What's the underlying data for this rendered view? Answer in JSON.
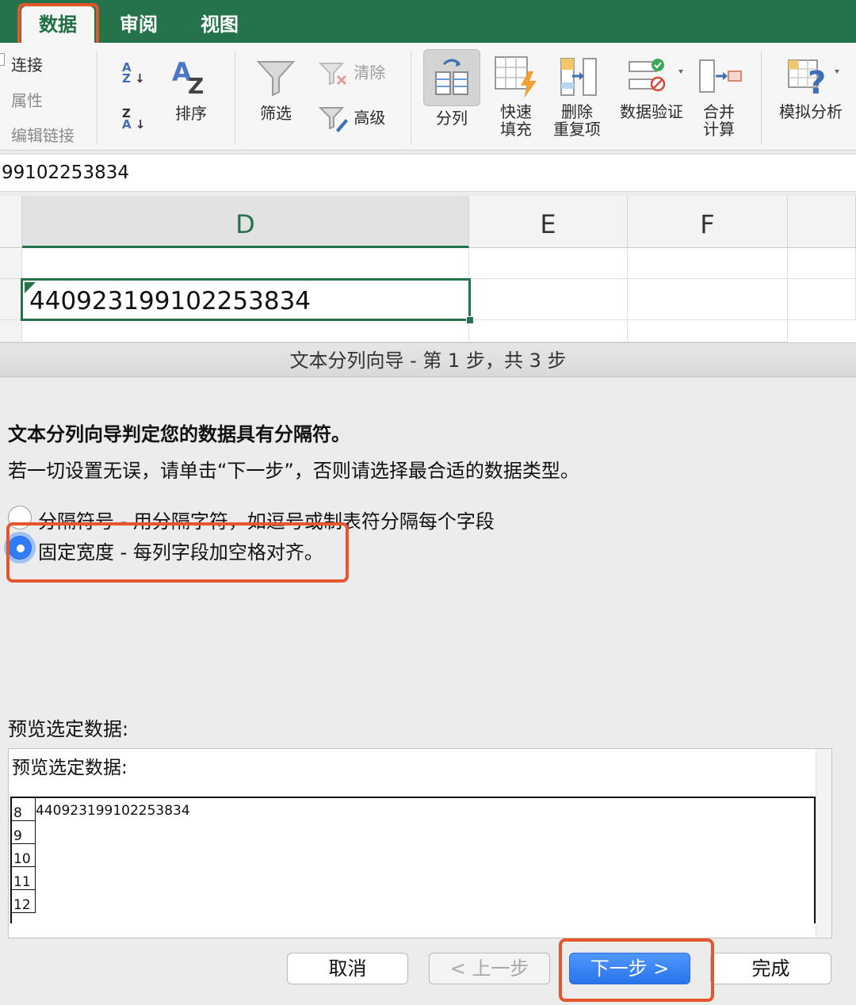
{
  "ribbon_tabs": {
    "data": "数据",
    "review": "审阅",
    "view": "视图"
  },
  "colors": {
    "excel_green": "#25734a",
    "highlight": "#e4572e",
    "primary_button": "#2a73ea"
  },
  "ribbon": {
    "connect": "连接",
    "properties": "属性",
    "edit_links": "编辑链接",
    "sort": "排序",
    "filter": "筛选",
    "clear": "清除",
    "advanced": "高级",
    "text_to_columns": "分列",
    "flash_fill_1": "快速",
    "flash_fill_2": "填充",
    "remove_dup_1": "删除",
    "remove_dup_2": "重复项",
    "data_validation": "数据验证",
    "consolidate_1": "合并",
    "consolidate_2": "计算",
    "what_if": "模拟分析",
    "icons": [
      "sort-ascending-icon",
      "sort-descending-icon",
      "sort-az-icon",
      "filter-funnel-icon",
      "clear-filter-icon",
      "advanced-filter-icon",
      "text-to-columns-icon",
      "flash-fill-icon",
      "remove-duplicates-icon",
      "data-validation-icon",
      "consolidate-icon",
      "what-if-icon"
    ]
  },
  "formula_bar": {
    "value": "99102253834"
  },
  "grid": {
    "columns": [
      "D",
      "E",
      "F"
    ],
    "selected_cell_value": "440923199102253834"
  },
  "dialog": {
    "title": "文本分列向导 - 第 1 步，共 3 步",
    "heading": "文本分列向导判定您的数据具有分隔符。",
    "subtext": "若一切设置无误，请单击“下一步”，否则请选择最合适的数据类型。",
    "options": [
      {
        "label": "分隔符号 - 用分隔字符，如逗号或制表符分隔每个字段",
        "selected": false
      },
      {
        "label": "固定宽度 - 每列字段加空格对齐。",
        "selected": true
      }
    ],
    "preview_label": "预览选定数据:",
    "preview_box_title": "预览选定数据:",
    "preview_rows": [
      {
        "num": "8",
        "value": "440923199102253834"
      },
      {
        "num": "9",
        "value": ""
      },
      {
        "num": "10",
        "value": ""
      },
      {
        "num": "11",
        "value": ""
      },
      {
        "num": "12",
        "value": ""
      }
    ],
    "buttons": {
      "cancel": "取消",
      "back": "< 上一步",
      "next": "下一步 >",
      "finish": "完成"
    }
  }
}
